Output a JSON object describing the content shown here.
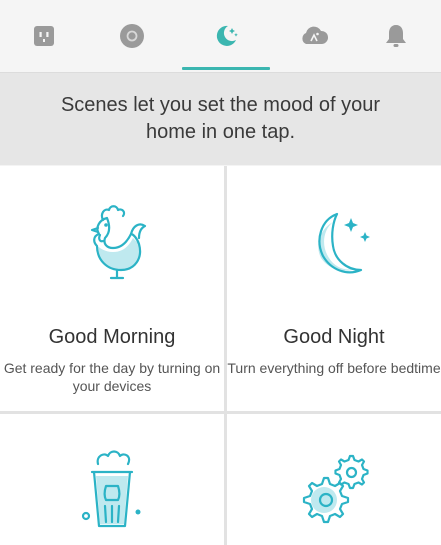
{
  "tabs": [
    {
      "name": "outlet-icon",
      "active": false
    },
    {
      "name": "circle-device-icon",
      "active": false
    },
    {
      "name": "scenes-moon-icon",
      "active": true
    },
    {
      "name": "cloud-icon",
      "active": false
    },
    {
      "name": "bell-icon",
      "active": false
    }
  ],
  "banner": {
    "text": "Scenes let you set the mood of your home in one tap."
  },
  "scenes": [
    {
      "title": "Good Morning",
      "description": "Get ready for the day by turning on your devices",
      "icon": "rooster-icon"
    },
    {
      "title": "Good Night",
      "description": "Turn everything off before bedtime",
      "icon": "moon-stars-icon"
    },
    {
      "title": "",
      "description": "",
      "icon": "popcorn-icon"
    },
    {
      "title": "",
      "description": "",
      "icon": "gears-icon"
    }
  ],
  "colors": {
    "accent": "#3bb6b0",
    "icon": "#2bb3c6",
    "tab_icon": "#9a9a9a"
  }
}
